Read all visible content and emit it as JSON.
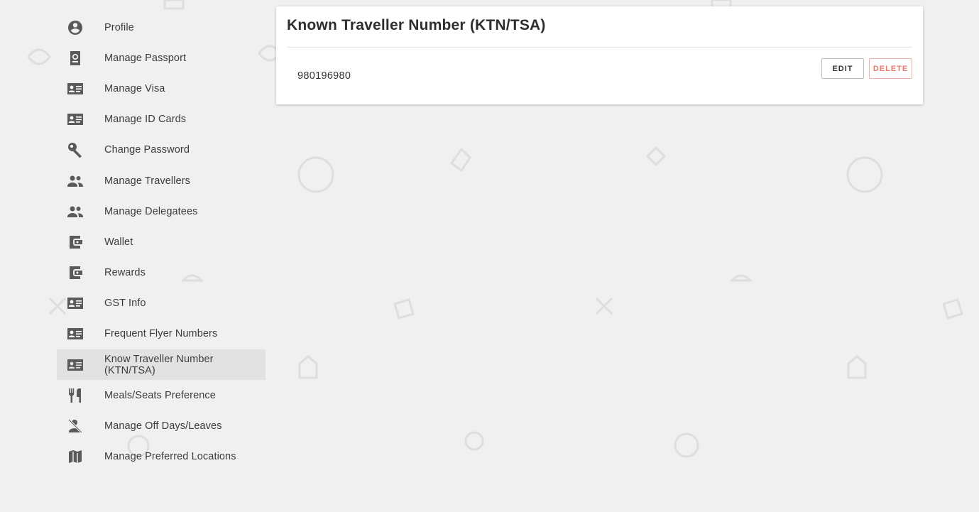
{
  "sidebar": {
    "items": [
      {
        "label": "Profile",
        "icon": "account-circle-icon",
        "active": false
      },
      {
        "label": "Manage Passport",
        "icon": "passport-icon",
        "active": false
      },
      {
        "label": "Manage Visa",
        "icon": "id-card-icon",
        "active": false
      },
      {
        "label": "Manage ID Cards",
        "icon": "id-card-icon",
        "active": false
      },
      {
        "label": "Change Password",
        "icon": "key-icon",
        "active": false
      },
      {
        "label": "Manage Travellers",
        "icon": "people-icon",
        "active": false
      },
      {
        "label": "Manage Delegatees",
        "icon": "people-icon",
        "active": false
      },
      {
        "label": "Wallet",
        "icon": "wallet-icon",
        "active": false
      },
      {
        "label": "Rewards",
        "icon": "wallet-icon",
        "active": false
      },
      {
        "label": "GST Info",
        "icon": "id-card-icon",
        "active": false
      },
      {
        "label": "Frequent Flyer Numbers",
        "icon": "id-card-icon",
        "active": false
      },
      {
        "label": "Know Traveller Number (KTN/TSA)",
        "icon": "id-card-icon",
        "active": true
      },
      {
        "label": "Meals/Seats Preference",
        "icon": "restaurant-icon",
        "active": false
      },
      {
        "label": "Manage Off Days/Leaves",
        "icon": "person-off-icon",
        "active": false
      },
      {
        "label": "Manage Preferred Locations",
        "icon": "map-icon",
        "active": false
      }
    ]
  },
  "panel": {
    "title": "Known Traveller Number (KTN/TSA)",
    "value": "980196980",
    "edit_label": "EDIT",
    "delete_label": "DELETE"
  },
  "colors": {
    "background": "#f0f0f0",
    "active_item": "#e2e2e2",
    "delete_accent": "#e8796a"
  }
}
